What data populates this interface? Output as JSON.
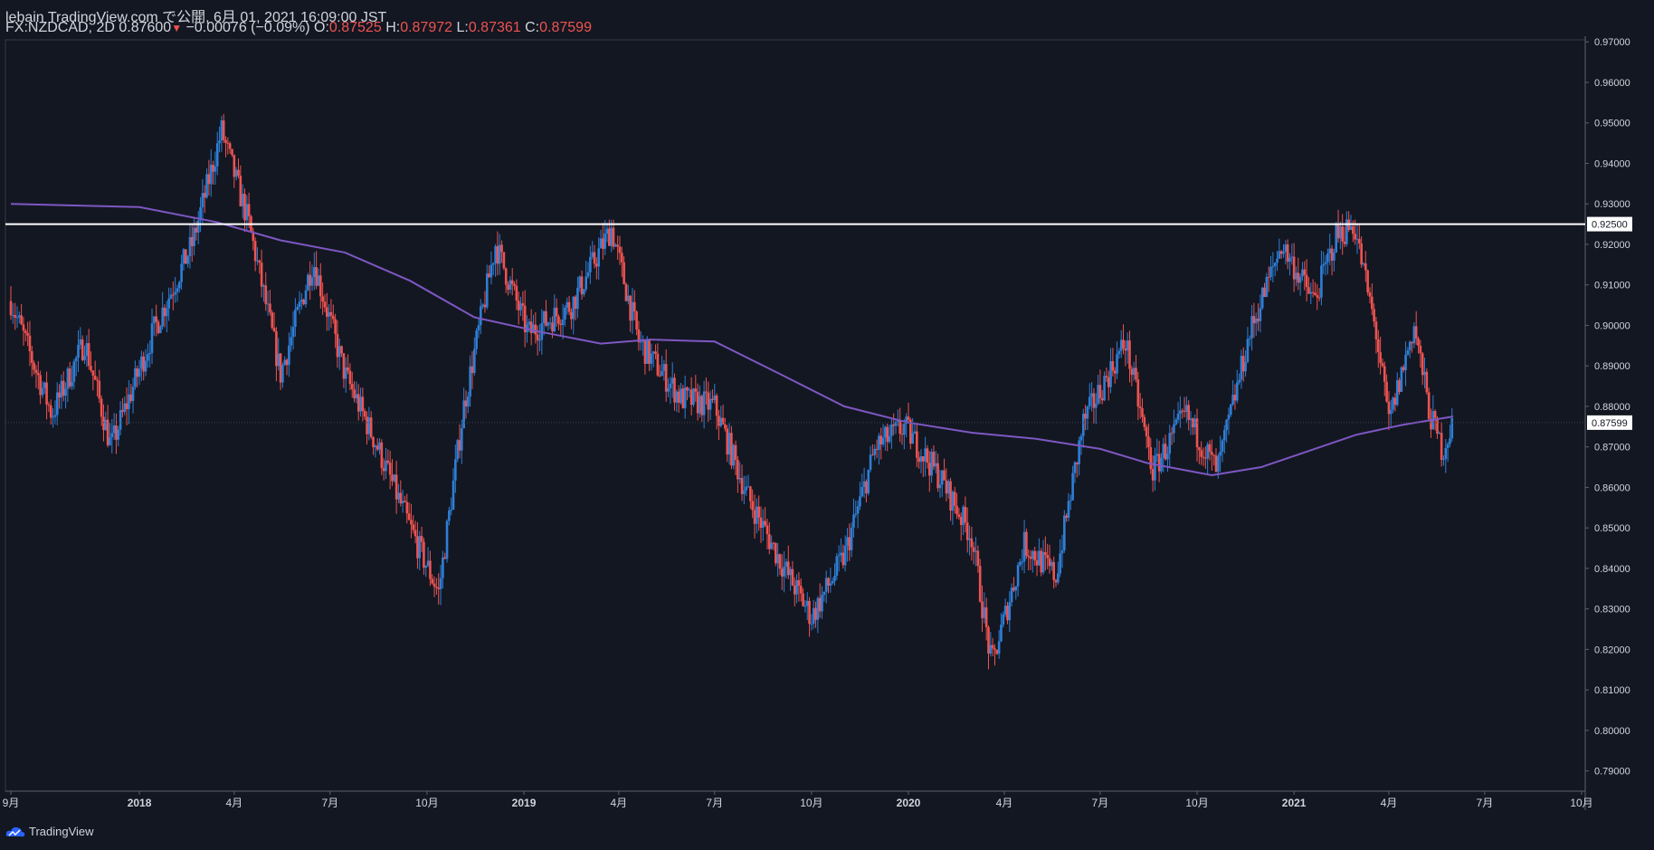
{
  "header": {
    "line1": "lebain TradingView.com で公開, 6月 01, 2021 16:09:00 JST",
    "symbol": "FX:NZDCAD, 2D",
    "last": "0.87600",
    "change": "−0.00076 (−0.09%)",
    "o_label": "O:",
    "o_value": "0.87525",
    "h_label": "H:",
    "h_value": "0.87972",
    "l_label": "L:",
    "l_value": "0.87361",
    "c_label": "C:",
    "c_value": "0.87599"
  },
  "colors": {
    "background": "#131722",
    "up": "#2e7fd6",
    "down": "#ef5350",
    "ma": "#7e57c2",
    "level_line": "#ffffff",
    "axis_text": "#d1d4dc"
  },
  "footer": {
    "brand": "TradingView"
  },
  "chart_data": {
    "type": "candlestick",
    "symbol": "FX:NZDCAD",
    "interval": "2D",
    "ylim": [
      0.785,
      0.9705
    ],
    "y_ticks": [
      "0.97000",
      "0.96000",
      "0.95000",
      "0.94000",
      "0.93000",
      "0.92000",
      "0.91000",
      "0.90000",
      "0.89000",
      "0.88000",
      "0.87000",
      "0.86000",
      "0.85000",
      "0.84000",
      "0.83000",
      "0.82000",
      "0.81000",
      "0.80000",
      "0.79000"
    ],
    "x_ticks": [
      {
        "label": "9月",
        "date": "2017-09-01"
      },
      {
        "label": "2018",
        "date": "2018-01-01"
      },
      {
        "label": "4月",
        "date": "2018-04-01"
      },
      {
        "label": "7月",
        "date": "2018-07-01"
      },
      {
        "label": "10月",
        "date": "2018-10-01"
      },
      {
        "label": "2019",
        "date": "2019-01-01"
      },
      {
        "label": "4月",
        "date": "2019-04-01"
      },
      {
        "label": "7月",
        "date": "2019-07-01"
      },
      {
        "label": "10月",
        "date": "2019-10-01"
      },
      {
        "label": "2020",
        "date": "2020-01-01"
      },
      {
        "label": "4月",
        "date": "2020-04-01"
      },
      {
        "label": "7月",
        "date": "2020-07-01"
      },
      {
        "label": "10月",
        "date": "2020-10-01"
      },
      {
        "label": "2021",
        "date": "2021-01-01"
      },
      {
        "label": "4月",
        "date": "2021-04-01"
      },
      {
        "label": "7月",
        "date": "2021-07-01"
      },
      {
        "label": "10月",
        "date": "2021-10-01"
      }
    ],
    "x_range": [
      "2017-09-01",
      "2021-10-01"
    ],
    "horizontal_line": {
      "value": 0.925,
      "label": "0.92500"
    },
    "last_price": {
      "value": 0.87599,
      "label": "0.87599"
    },
    "price_path": [
      {
        "date": "2017-09-01",
        "price": 0.906
      },
      {
        "date": "2017-10-10",
        "price": 0.878
      },
      {
        "date": "2017-11-10",
        "price": 0.896
      },
      {
        "date": "2017-12-05",
        "price": 0.87
      },
      {
        "date": "2018-01-15",
        "price": 0.899
      },
      {
        "date": "2018-02-20",
        "price": 0.92
      },
      {
        "date": "2018-03-20",
        "price": 0.948
      },
      {
        "date": "2018-04-15",
        "price": 0.925
      },
      {
        "date": "2018-05-15",
        "price": 0.888
      },
      {
        "date": "2018-06-15",
        "price": 0.916
      },
      {
        "date": "2018-07-15",
        "price": 0.888
      },
      {
        "date": "2018-08-15",
        "price": 0.87
      },
      {
        "date": "2018-09-15",
        "price": 0.85
      },
      {
        "date": "2018-10-12",
        "price": 0.834
      },
      {
        "date": "2018-11-05",
        "price": 0.88
      },
      {
        "date": "2018-12-05",
        "price": 0.92
      },
      {
        "date": "2019-01-05",
        "price": 0.898
      },
      {
        "date": "2019-02-15",
        "price": 0.905
      },
      {
        "date": "2019-03-25",
        "price": 0.924
      },
      {
        "date": "2019-04-20",
        "price": 0.896
      },
      {
        "date": "2019-05-30",
        "price": 0.882
      },
      {
        "date": "2019-07-01",
        "price": 0.88
      },
      {
        "date": "2019-08-01",
        "price": 0.858
      },
      {
        "date": "2019-09-01",
        "price": 0.842
      },
      {
        "date": "2019-10-01",
        "price": 0.828
      },
      {
        "date": "2019-11-01",
        "price": 0.843
      },
      {
        "date": "2019-12-01",
        "price": 0.87
      },
      {
        "date": "2019-12-28",
        "price": 0.875
      },
      {
        "date": "2020-02-01",
        "price": 0.862
      },
      {
        "date": "2020-03-01",
        "price": 0.848
      },
      {
        "date": "2020-03-20",
        "price": 0.816
      },
      {
        "date": "2020-04-20",
        "price": 0.846
      },
      {
        "date": "2020-05-20",
        "price": 0.838
      },
      {
        "date": "2020-06-15",
        "price": 0.876
      },
      {
        "date": "2020-07-25",
        "price": 0.896
      },
      {
        "date": "2020-08-20",
        "price": 0.864
      },
      {
        "date": "2020-09-20",
        "price": 0.878
      },
      {
        "date": "2020-10-20",
        "price": 0.864
      },
      {
        "date": "2020-11-20",
        "price": 0.898
      },
      {
        "date": "2020-12-20",
        "price": 0.92
      },
      {
        "date": "2021-01-20",
        "price": 0.906
      },
      {
        "date": "2021-02-10",
        "price": 0.922
      },
      {
        "date": "2021-02-27",
        "price": 0.925
      },
      {
        "date": "2021-03-20",
        "price": 0.898
      },
      {
        "date": "2021-04-01",
        "price": 0.876
      },
      {
        "date": "2021-04-25",
        "price": 0.9
      },
      {
        "date": "2021-05-10",
        "price": 0.878
      },
      {
        "date": "2021-05-22",
        "price": 0.869
      },
      {
        "date": "2021-06-01",
        "price": 0.876
      }
    ],
    "moving_average": [
      {
        "date": "2017-09-01",
        "value": 0.93
      },
      {
        "date": "2018-01-01",
        "value": 0.9292
      },
      {
        "date": "2018-03-15",
        "value": 0.9255
      },
      {
        "date": "2018-05-15",
        "value": 0.921
      },
      {
        "date": "2018-07-15",
        "value": 0.918
      },
      {
        "date": "2018-09-15",
        "value": 0.911
      },
      {
        "date": "2018-11-15",
        "value": 0.902
      },
      {
        "date": "2019-01-15",
        "value": 0.8985
      },
      {
        "date": "2019-03-15",
        "value": 0.8955
      },
      {
        "date": "2019-05-01",
        "value": 0.8965
      },
      {
        "date": "2019-07-01",
        "value": 0.896
      },
      {
        "date": "2019-09-01",
        "value": 0.888
      },
      {
        "date": "2019-11-01",
        "value": 0.88
      },
      {
        "date": "2020-01-01",
        "value": 0.876
      },
      {
        "date": "2020-03-01",
        "value": 0.8735
      },
      {
        "date": "2020-05-01",
        "value": 0.872
      },
      {
        "date": "2020-07-01",
        "value": 0.8695
      },
      {
        "date": "2020-08-15",
        "value": 0.866
      },
      {
        "date": "2020-10-15",
        "value": 0.863
      },
      {
        "date": "2020-12-01",
        "value": 0.865
      },
      {
        "date": "2021-01-15",
        "value": 0.869
      },
      {
        "date": "2021-03-01",
        "value": 0.873
      },
      {
        "date": "2021-04-15",
        "value": 0.8755
      },
      {
        "date": "2021-06-01",
        "value": 0.8775
      }
    ]
  }
}
